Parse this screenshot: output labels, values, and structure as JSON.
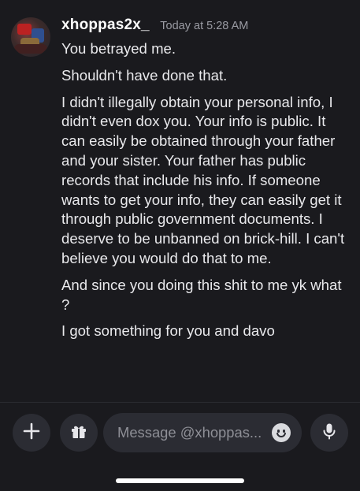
{
  "message": {
    "username": "xhoppas2x_",
    "timestamp": "Today at 5:28 AM",
    "lines": [
      "You betrayed me.",
      "Shouldn't have done that.",
      "I didn't illegally obtain your personal info, I didn't even dox you. Your info is public. It can easily be obtained through your father and your sister. Your father has public records that include his info. If someone wants to get your info, they can easily get it through public government documents. I deserve to be unbanned on brick-hill. I can't believe you would do that to me.",
      "And since you doing this shit to me yk what ?",
      "I got something for you and davo"
    ]
  },
  "composer": {
    "placeholder": "Message @xhoppas..."
  },
  "icons": [
    "plus-icon",
    "gift-icon",
    "emoji-icon",
    "microphone-icon"
  ],
  "colors": {
    "background": "#1a1a1e",
    "button_bg": "#2b2c33",
    "username": "#ffffff",
    "timestamp": "#9a9ba3",
    "text": "#e9e9ec"
  }
}
